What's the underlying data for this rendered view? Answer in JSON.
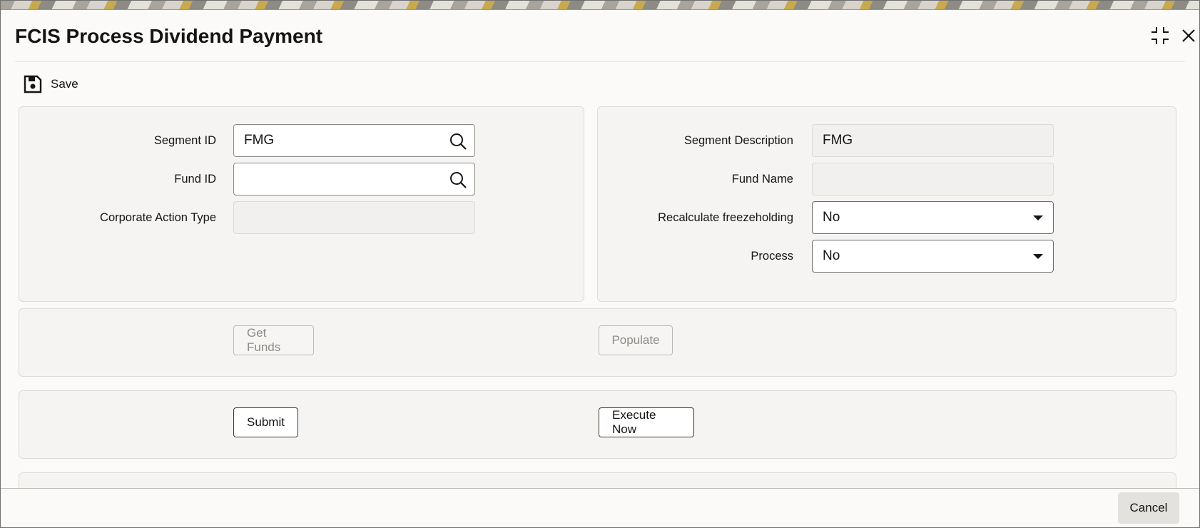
{
  "window": {
    "title": "FCIS Process Dividend Payment",
    "maximize_icon": "maximize-icon",
    "close_icon": "close-icon"
  },
  "toolbar": {
    "save_label": "Save",
    "save_icon": "save-disk-icon"
  },
  "left_panel": {
    "segment_id": {
      "label": "Segment ID",
      "value": "FMG"
    },
    "fund_id": {
      "label": "Fund ID",
      "value": ""
    },
    "corporate_action_type": {
      "label": "Corporate Action Type",
      "value": ""
    }
  },
  "right_panel": {
    "segment_description": {
      "label": "Segment Description",
      "value": "FMG"
    },
    "fund_name": {
      "label": "Fund Name",
      "value": ""
    },
    "recalculate_freezeholding": {
      "label": "Recalculate freezeholding",
      "value": "No"
    },
    "process": {
      "label": "Process",
      "value": "No"
    }
  },
  "actions_row1": {
    "get_funds": "Get Funds",
    "populate": "Populate"
  },
  "actions_row2": {
    "submit": "Submit",
    "execute_now": "Execute Now"
  },
  "footer": {
    "cancel": "Cancel"
  },
  "colors": {
    "background": "#fbfaf8",
    "panel": "#f5f4f2",
    "text": "#161513",
    "disabled_text": "#8e8b87"
  }
}
